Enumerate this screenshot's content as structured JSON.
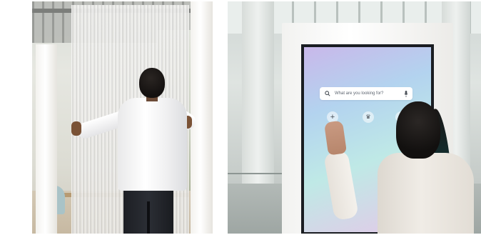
{
  "images": [
    {
      "name": "man-reaching-curtain-photo",
      "description": ""
    },
    {
      "name": "woman-touching-kiosk-photo",
      "kiosk": {
        "search": {
          "placeholder": "What are you looking for?"
        },
        "buttons": [
          {
            "icon": "plus-icon",
            "glyph": "+"
          },
          {
            "icon": "crown-icon",
            "glyph": "♛"
          },
          {
            "icon": "partial-icon",
            "glyph": ""
          }
        ]
      }
    }
  ]
}
